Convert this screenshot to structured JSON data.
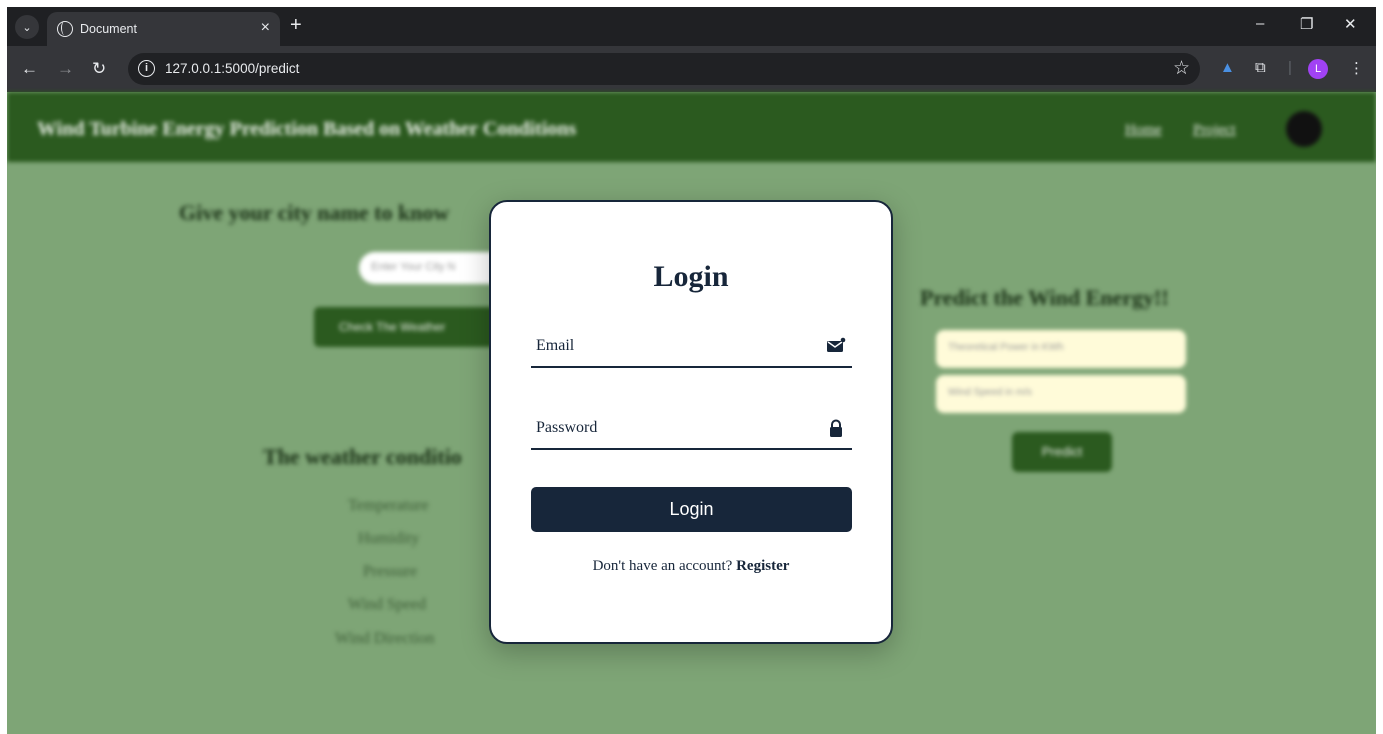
{
  "browser": {
    "tab_title": "Document",
    "tab_close": "×",
    "new_tab": "+",
    "url": "127.0.0.1:5000/predict",
    "profile_initial": "L",
    "window_controls": {
      "minimize": "–",
      "restore": "❐",
      "close": "✕"
    }
  },
  "site": {
    "title": "Wind Turbine Energy Prediction Based on Weather Conditions",
    "nav": [
      "Home",
      "Project"
    ]
  },
  "city_section": {
    "heading": "Give your city name to know",
    "input_placeholder": "Enter Your City N",
    "button": "Check The Weather"
  },
  "weather_section": {
    "heading": "The weather conditio",
    "items": [
      "Temperature",
      "Humidity",
      "Pressure",
      "Wind Speed",
      "Wind Direction"
    ]
  },
  "predict_section": {
    "heading": "Predict the Wind Energy!!",
    "inputs": [
      "Theoretical Power in KWh",
      "Wind Speed in m/s"
    ],
    "button": "Predict"
  },
  "login_modal": {
    "title": "Login",
    "email_placeholder": "Email",
    "password_placeholder": "Password",
    "button": "Login",
    "register_prompt": "Don't have an account?",
    "register_link": "Register"
  },
  "colors": {
    "page_bg": "#7ea576",
    "nav_bg": "#2b5a1f",
    "modal_dark": "#17263a",
    "input_yellow": "#fffbd9"
  }
}
